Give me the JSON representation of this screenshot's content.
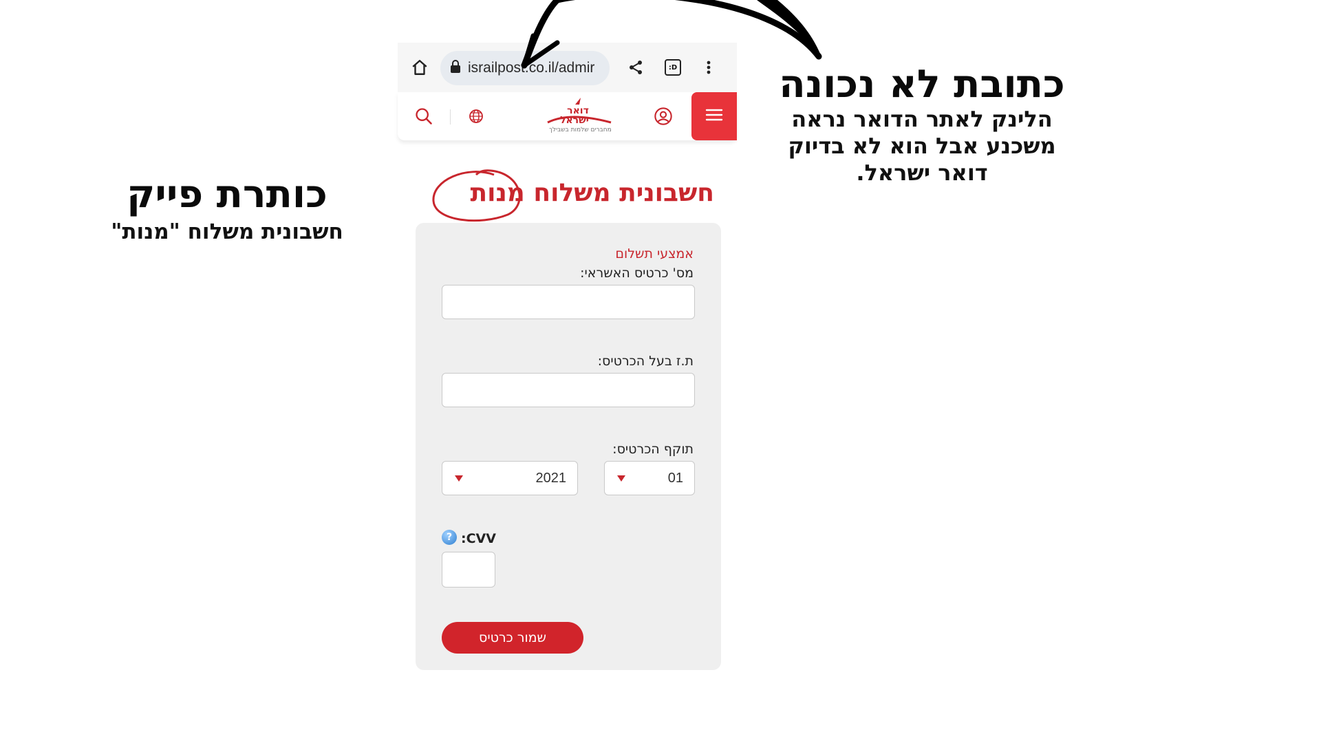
{
  "annotations": {
    "wrong_address": {
      "title": "כתובת לא נכונה",
      "lines": [
        "הלינק לאתר הדואר נראה",
        "משכנע אבל הוא לא בדיוק",
        "דואר ישראל."
      ]
    },
    "fake_title": {
      "title": "כותרת פייק",
      "body": "חשבונית משלוח \"מנות\""
    }
  },
  "browser": {
    "url": "israilpost.co.il/admir",
    "icons": [
      "home-icon",
      "lock-icon",
      "share-icon",
      "tabs-icon",
      "more-vert-icon"
    ],
    "tab_icon_text": ":D"
  },
  "site_header": {
    "logo_text_line1": "דואר",
    "logo_text_line2": "ישראל",
    "logo_tagline": "מחברים שלמות בשבילך",
    "icons": [
      "search-icon",
      "globe-icon",
      "user-icon",
      "menu-icon"
    ],
    "colors": {
      "brand": "#c8262d",
      "menu_bg": "#e8333a"
    }
  },
  "page": {
    "title": "חשבונית משלוח מנות"
  },
  "form": {
    "section_label": "אמצעי תשלום",
    "card_number_label": "מס' כרטיס האשראי:",
    "card_number_value": "",
    "id_label": "ת.ז בעל הכרטיס:",
    "id_value": "",
    "expiry_label": "תוקף הכרטיס:",
    "expiry_year": "2021",
    "expiry_month": "01",
    "cvv_label": ":CVV",
    "cvv_value": "",
    "help_glyph": "?",
    "submit_label": "שמור כרטיס"
  }
}
